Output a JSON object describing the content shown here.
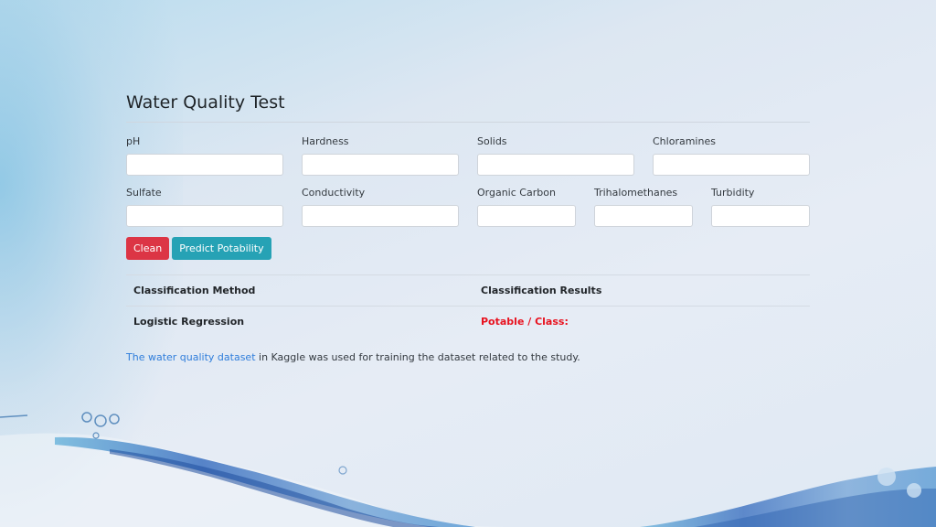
{
  "page": {
    "title": "Water Quality Test"
  },
  "form": {
    "fields_row1": [
      {
        "label": "pH",
        "value": ""
      },
      {
        "label": "Hardness",
        "value": ""
      },
      {
        "label": "Solids",
        "value": ""
      },
      {
        "label": "Chloramines",
        "value": ""
      }
    ],
    "fields_row2": [
      {
        "label": "Sulfate",
        "value": ""
      },
      {
        "label": "Conductivity",
        "value": ""
      },
      {
        "label": "Organic Carbon",
        "value": ""
      },
      {
        "label": "Trihalomethanes",
        "value": ""
      },
      {
        "label": "Turbidity",
        "value": ""
      }
    ],
    "buttons": {
      "clean": "Clean",
      "predict": "Predict Potability"
    }
  },
  "table": {
    "headers": [
      "Classification Method",
      "Classification Results"
    ],
    "rows": [
      {
        "method": "Logistic Regression",
        "result": "Potable / Class:"
      }
    ]
  },
  "footer_note": {
    "link_text": "The water quality dataset",
    "rest": " in Kaggle was used for training the dataset related to the study."
  },
  "colors": {
    "danger": "#dc3545",
    "info": "#26a2b5",
    "result_red": "#e8121f",
    "link": "#2f7ddb"
  }
}
